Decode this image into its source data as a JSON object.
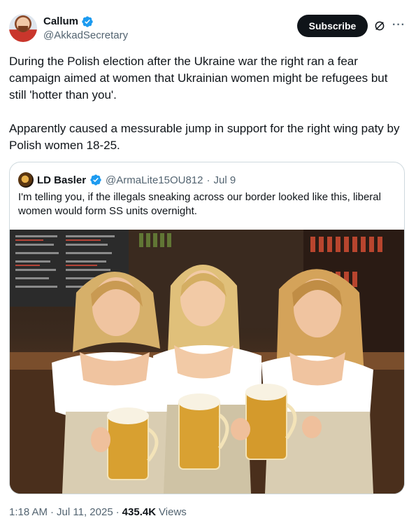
{
  "author": {
    "display_name": "Callum",
    "handle": "@AkkadSecretary"
  },
  "actions": {
    "subscribe_label": "Subscribe"
  },
  "tweet": {
    "paragraphs": [
      "During the Polish election after the Ukraine war the right ran a fear campaign aimed at women that Ukrainian women might be refugees but still 'hotter than you'.",
      "Apparently caused a messurable jump in support for the right wing paty by Polish women 18-25."
    ]
  },
  "quote": {
    "display_name": "LD Basler",
    "handle": "@ArmaLite15OU812",
    "separator": "·",
    "date": "Jul 9",
    "text": "I'm telling you, if the illegals sneaking across our border looked like this, liberal women would form SS units overnight."
  },
  "meta": {
    "time": "1:18 AM",
    "sep1": "·",
    "date": "Jul 11, 2025",
    "sep2": "·",
    "views_count": "435.4K",
    "views_label": "Views"
  },
  "colors": {
    "verified_blue": "#1d9bf0",
    "text_primary": "#0f1419",
    "text_secondary": "#536471",
    "border": "#cfd9de"
  },
  "icons": {
    "verified": "verified-badge-icon",
    "grok": "grok-icon",
    "more": "more-icon"
  }
}
